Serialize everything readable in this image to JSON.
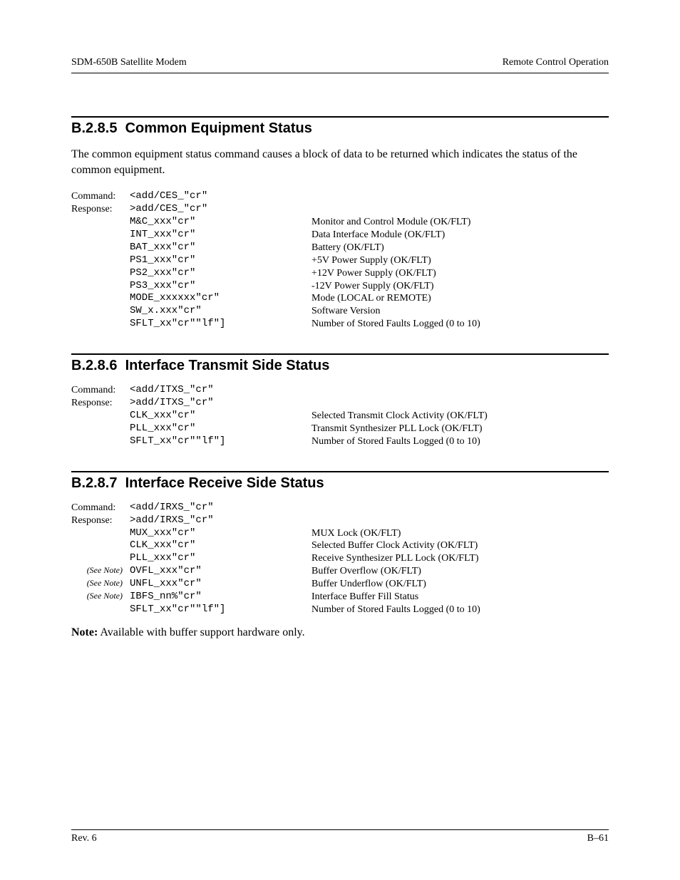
{
  "header": {
    "left": "SDM-650B Satellite Modem",
    "right": "Remote Control Operation"
  },
  "footer": {
    "left": "Rev. 6",
    "right": "B–61"
  },
  "sections": [
    {
      "num": "B.2.8.5",
      "title": "Common Equipment Status",
      "intro": "The common equipment status command causes a block of data to be returned which indicates the status of the common equipment.",
      "cmdLabel": "Command:",
      "respLabel": "Response:",
      "cmd": "<add/CES_\"cr\"",
      "rows": [
        {
          "code": ">add/CES_\"cr\"",
          "desc": ""
        },
        {
          "code": "M&C_xxx\"cr\"",
          "desc": "Monitor and Control Module (OK/FLT)"
        },
        {
          "code": "INT_xxx\"cr\"",
          "desc": "Data Interface Module (OK/FLT)"
        },
        {
          "code": "BAT_xxx\"cr\"",
          "desc": "Battery (OK/FLT)"
        },
        {
          "code": "PS1_xxx\"cr\"",
          "desc": "+5V Power Supply (OK/FLT)"
        },
        {
          "code": "PS2_xxx\"cr\"",
          "desc": "+12V Power Supply (OK/FLT)"
        },
        {
          "code": "PS3_xxx\"cr\"",
          "desc": "-12V Power Supply (OK/FLT)"
        },
        {
          "code": "MODE_xxxxxx\"cr\"",
          "desc": "Mode (LOCAL or REMOTE)"
        },
        {
          "code": "SW_x.xxx\"cr\"",
          "desc": "Software Version"
        },
        {
          "code": "SFLT_xx\"cr\"\"lf\"]",
          "desc": "Number of Stored Faults Logged (0 to 10)"
        }
      ]
    },
    {
      "num": "B.2.8.6",
      "title": "Interface Transmit Side Status",
      "cmdLabel": "Command:",
      "respLabel": "Response:",
      "cmd": "<add/ITXS_\"cr\"",
      "rows": [
        {
          "code": ">add/ITXS_\"cr\"",
          "desc": ""
        },
        {
          "code": "CLK_xxx\"cr\"",
          "desc": "Selected Transmit Clock Activity (OK/FLT)"
        },
        {
          "code": "PLL_xxx\"cr\"",
          "desc": "Transmit Synthesizer PLL Lock (OK/FLT)"
        },
        {
          "code": "SFLT_xx\"cr\"\"lf\"]",
          "desc": "Number of Stored Faults Logged (0 to 10)"
        }
      ]
    },
    {
      "num": "B.2.8.7",
      "title": "Interface Receive Side Status",
      "cmdLabel": "Command:",
      "respLabel": "Response:",
      "cmd": "<add/IRXS_\"cr\"",
      "rows": [
        {
          "code": ">add/IRXS_\"cr\"",
          "desc": ""
        },
        {
          "code": "MUX_xxx\"cr\"",
          "desc": "MUX Lock (OK/FLT)"
        },
        {
          "code": "CLK_xxx\"cr\"",
          "desc": "Selected Buffer Clock Activity (OK/FLT)"
        },
        {
          "code": "PLL_xxx\"cr\"",
          "desc": "Receive Synthesizer PLL Lock (OK/FLT)"
        },
        {
          "note": "(See Note)",
          "code": "OVFL_xxx\"cr\"",
          "desc": "Buffer Overflow (OK/FLT)"
        },
        {
          "note": "(See Note)",
          "code": "UNFL_xxx\"cr\"",
          "desc": "Buffer Underflow (OK/FLT)"
        },
        {
          "note": "(See Note)",
          "code": "IBFS_nn%\"cr\"",
          "desc": "Interface Buffer Fill Status"
        },
        {
          "code": "SFLT_xx\"cr\"\"lf\"]",
          "desc": "Number of Stored Faults Logged (0 to 10)"
        }
      ],
      "noteLabel": "Note:",
      "noteText": " Available with buffer support hardware only."
    }
  ]
}
